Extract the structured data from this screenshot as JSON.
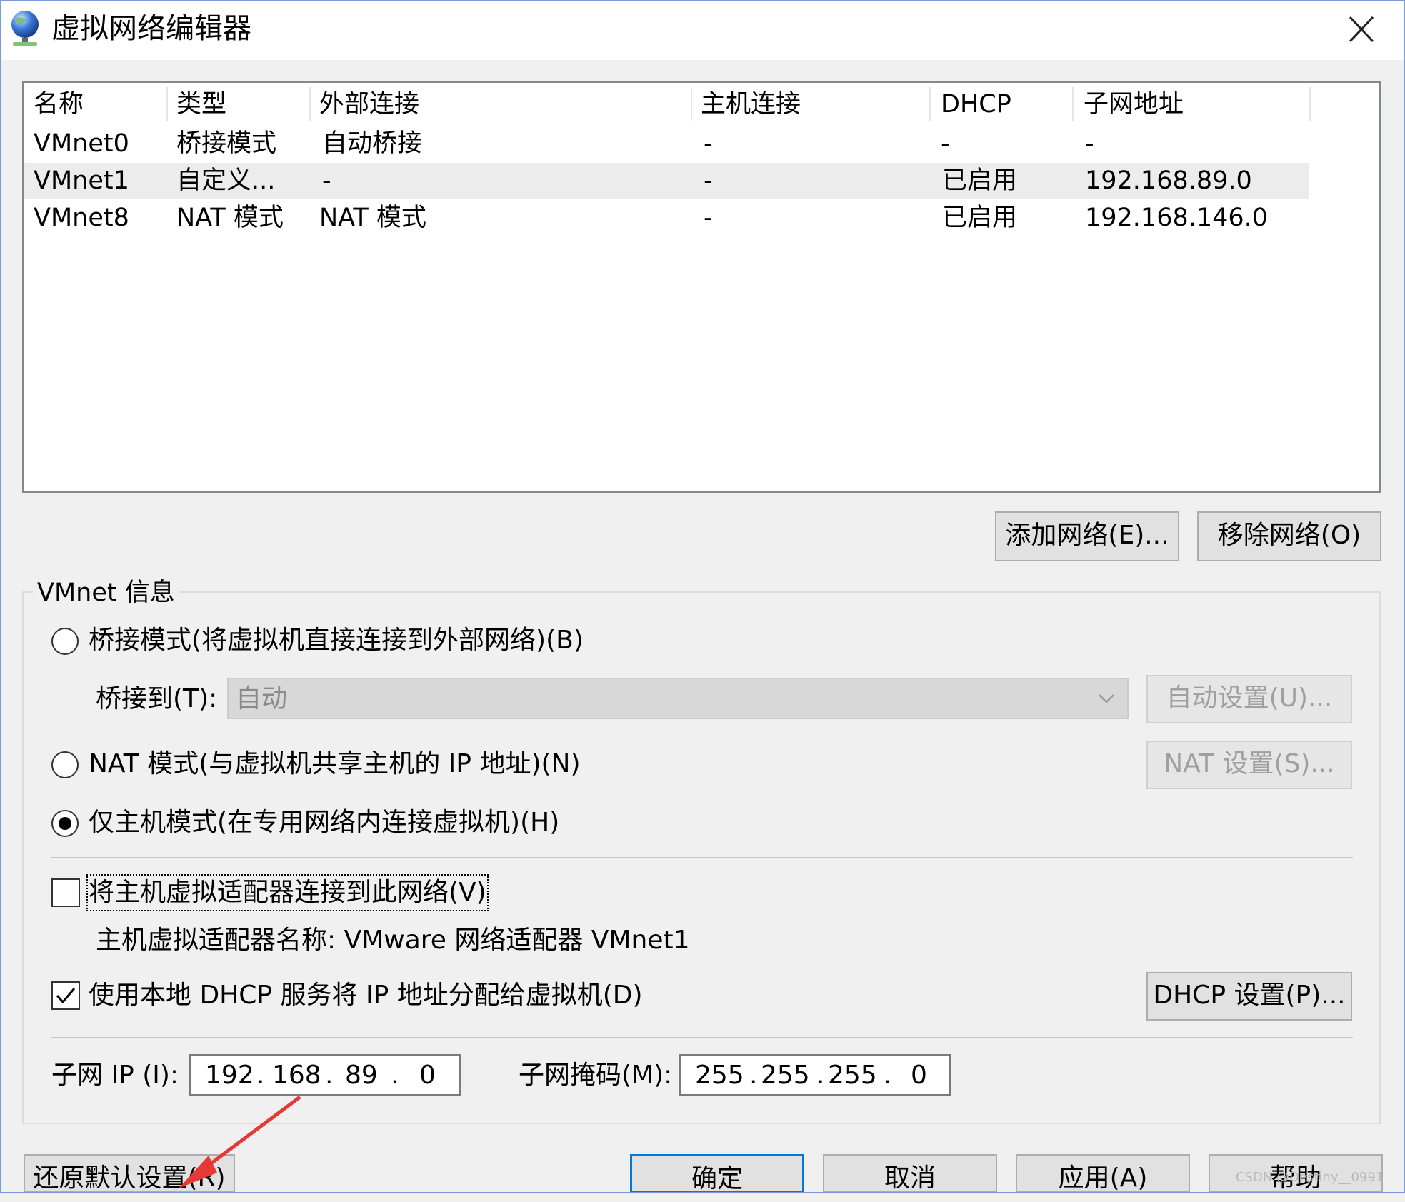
{
  "window": {
    "title": "虚拟网络编辑器"
  },
  "network_list": {
    "columns": [
      "名称",
      "类型",
      "外部连接",
      "主机连接",
      "DHCP",
      "子网地址"
    ],
    "rows": [
      [
        "VMnet0",
        "桥接模式",
        "自动桥接",
        "-",
        "-",
        "-"
      ],
      [
        "VMnet1",
        "自定义...",
        "-",
        "-",
        "已启用",
        "192.168.89.0"
      ],
      [
        "VMnet8",
        "NAT 模式",
        "NAT 模式",
        "-",
        "已启用",
        "192.168.146.0"
      ]
    ],
    "selected_row": "VMnet1"
  },
  "list_buttons": {
    "add": "添加网络(E)...",
    "remove": "移除网络(O)"
  },
  "vmnet_info": {
    "group_label": "VMnet 信息",
    "bridged_radio": "桥接模式(将虚拟机直接连接到外部网络)(B)",
    "bridge_to_label": "桥接到(T):",
    "bridge_to_value": "自动",
    "auto_settings_button": "自动设置(U)...",
    "nat_radio": "NAT 模式(与虚拟机共享主机的 IP 地址)(N)",
    "nat_settings_button": "NAT 设置(S)...",
    "hostonly_radio": "仅主机模式(在专用网络内连接虚拟机)(H)",
    "selected_mode": "hostonly",
    "connect_adapter_checkbox": "将主机虚拟适配器连接到此网络(V)",
    "connect_adapter_checked": false,
    "adapter_name_text": "主机虚拟适配器名称: VMware 网络适配器 VMnet1",
    "dhcp_checkbox": "使用本地 DHCP 服务将 IP 地址分配给虚拟机(D)",
    "dhcp_checked": true,
    "dhcp_settings_button": "DHCP 设置(P)...",
    "subnet_ip_label": "子网 IP (I):",
    "subnet_ip": [
      "192",
      "168",
      "89",
      "0"
    ],
    "subnet_mask_label": "子网掩码(M):",
    "subnet_mask": [
      "255",
      "255",
      "255",
      "0"
    ]
  },
  "footer_buttons": {
    "restore": "还原默认设置(R)",
    "ok": "确定",
    "cancel": "取消",
    "apply": "应用(A)",
    "help": "帮助"
  },
  "watermark": "CSDN @Destiny__0991",
  "colors": {
    "accent": "#0078d7",
    "annotation_arrow": "#e53935"
  }
}
